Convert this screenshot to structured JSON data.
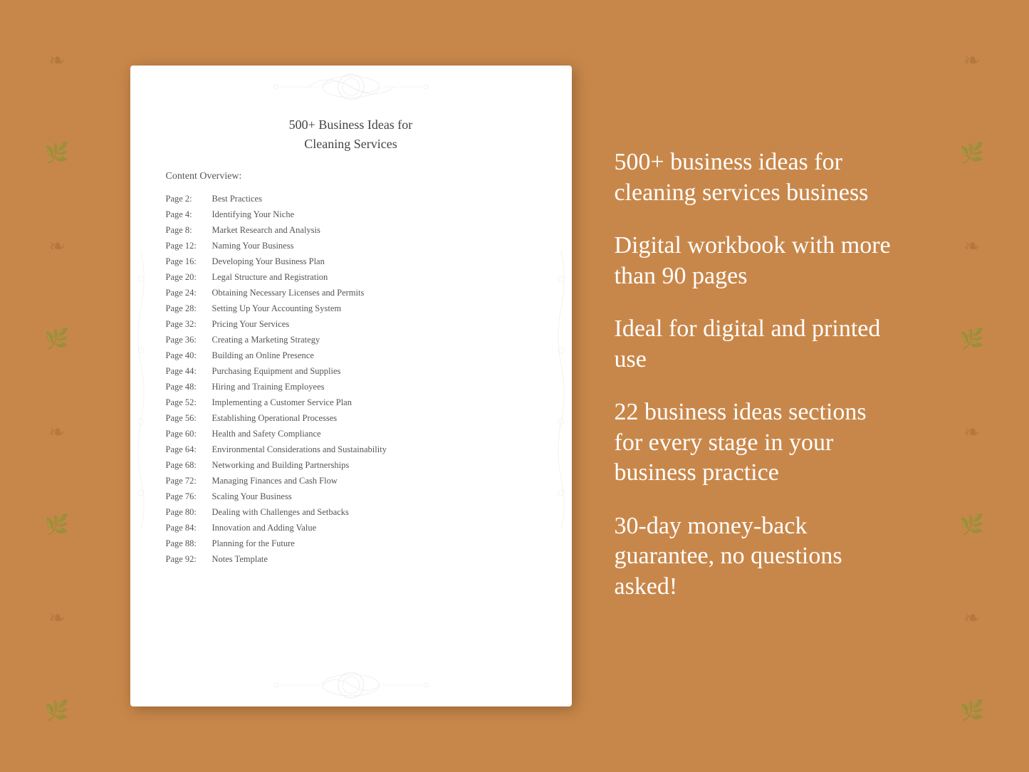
{
  "background": {
    "color": "#C8874A"
  },
  "document": {
    "title_line1": "500+ Business Ideas for",
    "title_line2": "Cleaning Services",
    "content_overview_label": "Content Overview:",
    "toc_items": [
      {
        "page": "Page  2:",
        "title": "Best Practices"
      },
      {
        "page": "Page  4:",
        "title": "Identifying Your Niche"
      },
      {
        "page": "Page  8:",
        "title": "Market Research and Analysis"
      },
      {
        "page": "Page 12:",
        "title": "Naming Your Business"
      },
      {
        "page": "Page 16:",
        "title": "Developing Your Business Plan"
      },
      {
        "page": "Page 20:",
        "title": "Legal Structure and Registration"
      },
      {
        "page": "Page 24:",
        "title": "Obtaining Necessary Licenses and Permits"
      },
      {
        "page": "Page 28:",
        "title": "Setting Up Your Accounting System"
      },
      {
        "page": "Page 32:",
        "title": "Pricing Your Services"
      },
      {
        "page": "Page 36:",
        "title": "Creating a Marketing Strategy"
      },
      {
        "page": "Page 40:",
        "title": "Building an Online Presence"
      },
      {
        "page": "Page 44:",
        "title": "Purchasing Equipment and Supplies"
      },
      {
        "page": "Page 48:",
        "title": "Hiring and Training Employees"
      },
      {
        "page": "Page 52:",
        "title": "Implementing a Customer Service Plan"
      },
      {
        "page": "Page 56:",
        "title": "Establishing Operational Processes"
      },
      {
        "page": "Page 60:",
        "title": "Health and Safety Compliance"
      },
      {
        "page": "Page 64:",
        "title": "Environmental Considerations and Sustainability"
      },
      {
        "page": "Page 68:",
        "title": "Networking and Building Partnerships"
      },
      {
        "page": "Page 72:",
        "title": "Managing Finances and Cash Flow"
      },
      {
        "page": "Page 76:",
        "title": "Scaling Your Business"
      },
      {
        "page": "Page 80:",
        "title": "Dealing with Challenges and Setbacks"
      },
      {
        "page": "Page 84:",
        "title": "Innovation and Adding Value"
      },
      {
        "page": "Page 88:",
        "title": "Planning for the Future"
      },
      {
        "page": "Page 92:",
        "title": "Notes Template"
      }
    ]
  },
  "features": [
    {
      "text": "500+ business ideas for cleaning services business"
    },
    {
      "text": "Digital workbook with more than 90 pages"
    },
    {
      "text": "Ideal for digital and printed use"
    },
    {
      "text": "22 business ideas sections for every stage in your business practice"
    },
    {
      "text": "30-day money-back guarantee, no questions asked!"
    }
  ]
}
